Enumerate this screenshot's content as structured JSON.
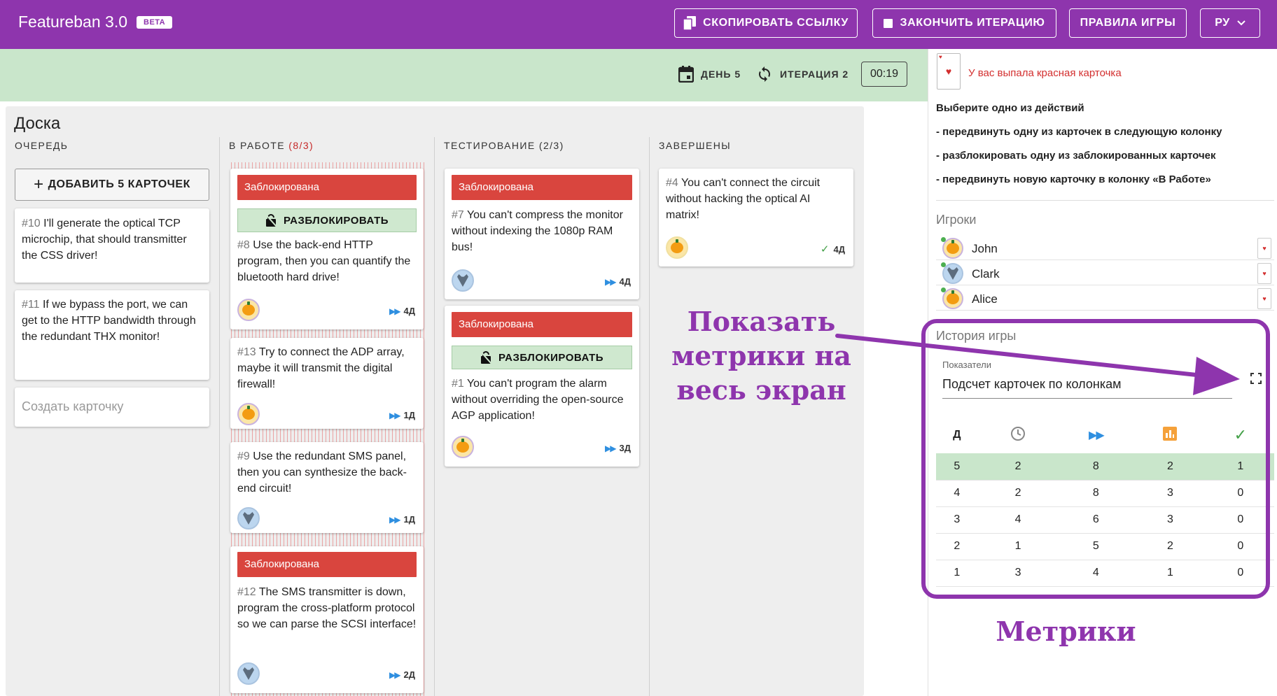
{
  "app": {
    "title": "Featureban 3.0",
    "badge": "BETA"
  },
  "toolbar": {
    "copy_link": "СКОПИРОВАТЬ ССЫЛКУ",
    "end_iteration": "ЗАКОНЧИТЬ ИТЕРАЦИЮ",
    "rules": "ПРАВИЛА ИГРЫ",
    "lang": "РУ"
  },
  "status": {
    "day": "ДЕНЬ 5",
    "iteration": "ИТЕРАЦИЯ 2",
    "timer": "00:19"
  },
  "board": {
    "title": "Доска",
    "columns": [
      {
        "name": "ОЧЕРЕДЬ",
        "count": ""
      },
      {
        "name": "В РАБОТЕ",
        "count": "(8/3)"
      },
      {
        "name": "ТЕСТИРОВАНИЕ",
        "count": "(2/3)"
      },
      {
        "name": "ЗАВЕРШЕНЫ",
        "count": ""
      }
    ],
    "add_cards": "ДОБАВИТЬ 5 КАРТОЧЕК",
    "create_placeholder": "Создать карточку",
    "blocked_label": "Заблокирована",
    "unblock_label": "РАЗБЛОКИРОВАТЬ",
    "queue": [
      {
        "num": "#10",
        "text": " I'll generate the optical TCP microchip, that should transmitter the CSS driver!"
      },
      {
        "num": "#11",
        "text": " If we bypass the port, we can get to the HTTP bandwidth through the redundant THX monitor!"
      }
    ],
    "in_work": [
      {
        "num": "#8",
        "text": " Use the back-end HTTP program, then you can quantify the bluetooth hard drive!",
        "age": "4Д"
      },
      {
        "num": "#13",
        "text": " Try to connect the ADP array, maybe it will transmit the digital firewall!",
        "age": "1Д"
      },
      {
        "num": "#9",
        "text": " Use the redundant SMS panel, then you can synthesize the back-end circuit!",
        "age": "1Д"
      },
      {
        "num": "#12",
        "text": " The SMS transmitter is down, program the cross-platform protocol so we can parse the SCSI interface!",
        "age": "2Д"
      }
    ],
    "testing": [
      {
        "num": "#7",
        "text": " You can't compress the monitor without indexing the 1080p RAM bus!",
        "age": "4Д"
      },
      {
        "num": "#1",
        "text": " You can't program the alarm without overriding the open-source AGP application!",
        "age": "3Д"
      }
    ],
    "done": [
      {
        "num": "#4",
        "text": " You can't connect the circuit without hacking the optical AI matrix!",
        "age": "4Д"
      }
    ]
  },
  "panel": {
    "red_card_msg": "У вас выпала красная карточка",
    "choose": "Выберите одно из действий",
    "actions": [
      "- передвинуть одну из карточек в следующую колонку",
      "- разблокировать одну из заблокированных карточек",
      "- передвинуть новую карточку в колонку «В Работе»"
    ],
    "players_title": "Игроки",
    "players": [
      {
        "name": "John",
        "avatar": "pumpkin"
      },
      {
        "name": "Clark",
        "avatar": "wolf"
      },
      {
        "name": "Alice",
        "avatar": "pumpkin"
      }
    ],
    "history_title": "История игры",
    "metrics_label": "Показатели",
    "metrics_value": "Подсчет карточек по колонкам",
    "table_headers": [
      "Д",
      "clock-icon",
      "fast-forward-icon",
      "bar-chart-icon",
      "check-icon"
    ],
    "table_rows": [
      [
        "5",
        "2",
        "8",
        "2",
        "1"
      ],
      [
        "4",
        "2",
        "8",
        "3",
        "0"
      ],
      [
        "3",
        "4",
        "6",
        "3",
        "0"
      ],
      [
        "2",
        "1",
        "5",
        "2",
        "0"
      ],
      [
        "1",
        "3",
        "4",
        "1",
        "0"
      ]
    ]
  },
  "annotations": {
    "fullscreen_line1": "Показать",
    "fullscreen_line2": "метрики на",
    "fullscreen_line3": "весь экран",
    "metrics": "Метрики"
  },
  "colors": {
    "brand": "#8e35ad",
    "blocked": "#d9453e",
    "highlight": "#c9e6cb",
    "accent_blue": "#2f8fe0",
    "done_green": "#43a047"
  }
}
